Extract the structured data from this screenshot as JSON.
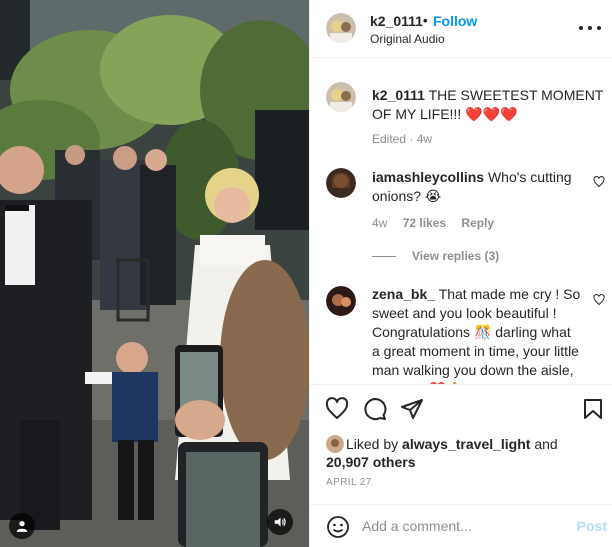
{
  "post": {
    "author": {
      "username": "k2_0111",
      "separator": "•",
      "follow_label": "Follow",
      "audio_label": "Original Audio",
      "avatar_icon": "profile-avatar-icon"
    },
    "caption": {
      "username": "k2_0111",
      "text": "THE SWEETEST MOMENT OF MY LIFE!!! ❤️❤️❤️",
      "meta": "Edited · 4w"
    },
    "comments": [
      {
        "username": "iamashleycollins",
        "text": "Who's cutting onions? 😭",
        "time": "4w",
        "likes": "72 likes",
        "reply_label": "Reply",
        "view_replies": "View replies (3)"
      },
      {
        "username": "zena_bk_",
        "text": "That made me cry ! So sweet and you look beautiful ! Congratulations 🎊 darling what a great moment in time, your little man walking you down the aisle, amazing ❤️🙏"
      }
    ],
    "likes": {
      "prefix": "Liked by",
      "liker": "always_travel_light",
      "conjunction": "and",
      "others": "20,907 others"
    },
    "date": "APRIL 27",
    "add_comment": {
      "placeholder": "Add a comment...",
      "post_label": "Post"
    }
  },
  "colors": {
    "link_blue": "#0095f6",
    "post_disabled": "#b2dffc",
    "secondary_text": "#8e8e8e",
    "primary_text": "#262626",
    "divider": "#efefef"
  },
  "icons": {
    "like": "heart-outline-icon",
    "comment": "speech-bubble-icon",
    "share": "paper-plane-icon",
    "save": "bookmark-icon",
    "more": "more-dots-icon",
    "emoji": "smiley-face-icon",
    "user_tag": "user-tag-icon",
    "sound": "speaker-icon"
  }
}
